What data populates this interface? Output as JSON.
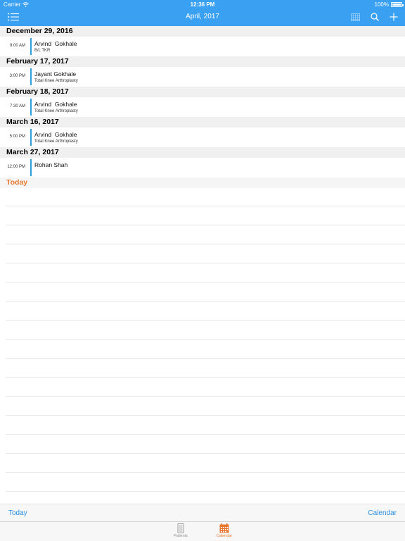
{
  "status_bar": {
    "carrier": "Carrier",
    "time": "12:36 PM",
    "battery": "100%"
  },
  "nav": {
    "title": "April, 2017",
    "icons": [
      "list-icon",
      "grid-icon",
      "search-icon",
      "add-icon"
    ]
  },
  "days": [
    {
      "date": "December 29, 2016",
      "appointments": [
        {
          "time": "9:00 AM",
          "name": "Arvind  Gokhale",
          "procedure": "B/L TKR"
        }
      ]
    },
    {
      "date": "February 17, 2017",
      "appointments": [
        {
          "time": "3:00 PM",
          "name": "Jayant Gokhale",
          "procedure": "Total Knee Arthroplasty"
        }
      ]
    },
    {
      "date": "February 18, 2017",
      "appointments": [
        {
          "time": "7:30 AM",
          "name": "Arvind  Gokhale",
          "procedure": "Total Knee Arthroplasty"
        }
      ]
    },
    {
      "date": "March 16, 2017",
      "appointments": [
        {
          "time": "5:00 PM",
          "name": "Arvind  Gokhale",
          "procedure": "Total Knee Arthroplasty"
        }
      ]
    },
    {
      "date": "March 27, 2017",
      "appointments": [
        {
          "time": "12:00 PM",
          "name": "Rohan Shah",
          "procedure": ""
        }
      ]
    }
  ],
  "today_label": "Today",
  "toolbar": {
    "left": "Today",
    "right": "Calendar"
  },
  "tabs": [
    {
      "label": "Patients",
      "icon": "patients-icon",
      "active": false
    },
    {
      "label": "Calendar",
      "icon": "calendar-icon",
      "active": true
    }
  ],
  "colors": {
    "nav_bg": "#3aa0f2",
    "accent_orange": "#e8772e",
    "link_blue": "#2a8ee0",
    "appt_bar": "#2f9dd8"
  }
}
